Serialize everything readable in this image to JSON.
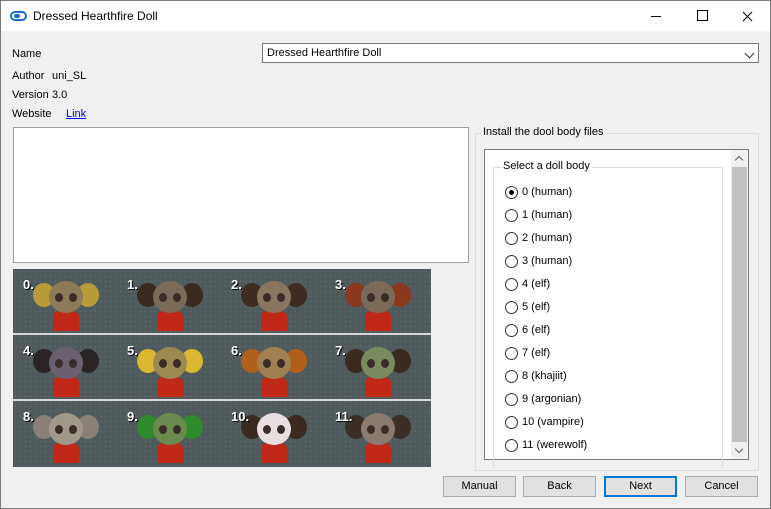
{
  "window": {
    "title": "Dressed Hearthfire Doll"
  },
  "info": {
    "name_label": "Name",
    "name_value": "Dressed Hearthfire Doll",
    "author_label": "Author",
    "author_value": "uni_SL",
    "version_label": "Version",
    "version_value": "3.0",
    "website_label": "Website",
    "website_link": "Link"
  },
  "preview": {
    "dolls": [
      {
        "num": "0.",
        "hair": "#b89a3a",
        "face": "#8c7a5a"
      },
      {
        "num": "1.",
        "hair": "#3a2a20",
        "face": "#7a6a58"
      },
      {
        "num": "2.",
        "hair": "#3e2c22",
        "face": "#8a7560"
      },
      {
        "num": "3.",
        "hair": "#8a3a1e",
        "face": "#7c6a58"
      },
      {
        "num": "4.",
        "hair": "#2a2424",
        "face": "#6a6070"
      },
      {
        "num": "5.",
        "hair": "#d8b830",
        "face": "#9a8a50"
      },
      {
        "num": "6.",
        "hair": "#b0601a",
        "face": "#a08050"
      },
      {
        "num": "7.",
        "hair": "#3a2a20",
        "face": "#7a8a60"
      },
      {
        "num": "8.",
        "hair": "#8a8078",
        "face": "#a09888"
      },
      {
        "num": "9.",
        "hair": "#2e8a2a",
        "face": "#6a8a50"
      },
      {
        "num": "10.",
        "hair": "#3a2a20",
        "face": "#e8e0e0"
      },
      {
        "num": "11.",
        "hair": "#3a2e26",
        "face": "#8a7a70"
      }
    ]
  },
  "install": {
    "group_title": "Install the dool body files",
    "select_title": "Select a doll body",
    "options": [
      "0 (human)",
      "1 (human)",
      "2 (human)",
      "3 (human)",
      "4 (elf)",
      "5 (elf)",
      "6 (elf)",
      "7 (elf)",
      "8 (khajiit)",
      "9 (argonian)",
      "10 (vampire)",
      "11 (werewolf)"
    ],
    "selected": "0 (human)"
  },
  "buttons": {
    "manual": "Manual",
    "back": "Back",
    "next": "Next",
    "cancel": "Cancel"
  }
}
